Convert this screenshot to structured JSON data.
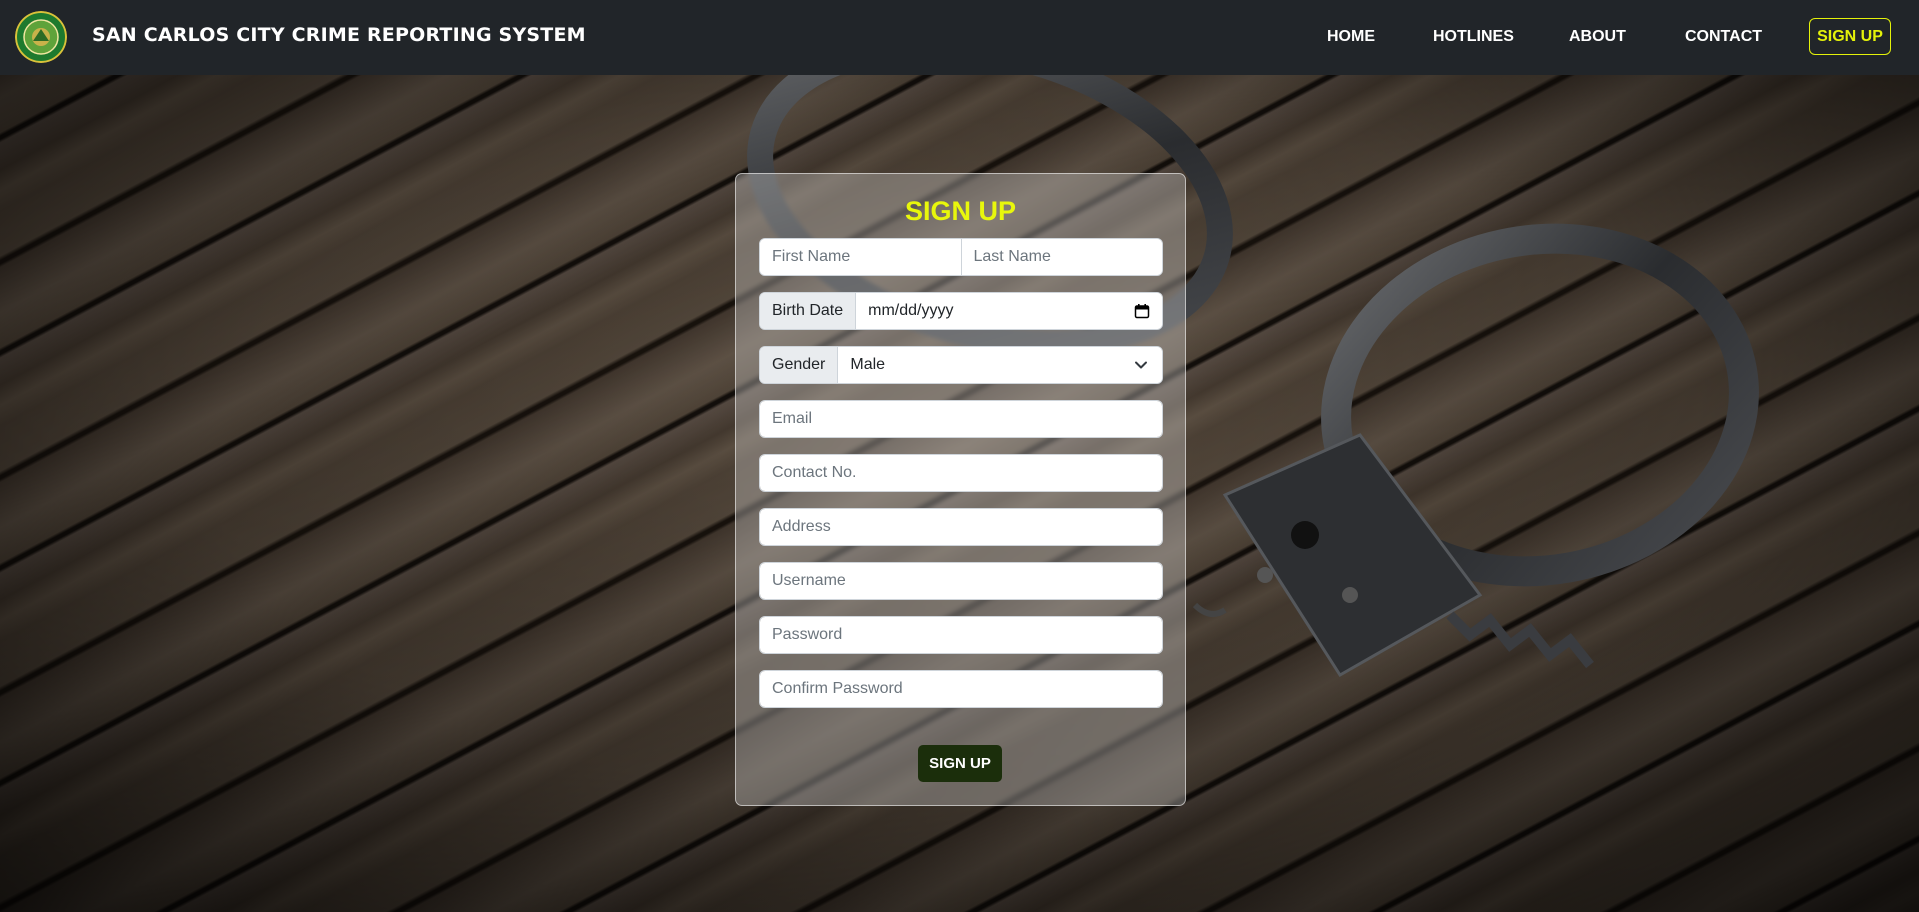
{
  "navbar": {
    "brand": "SAN CARLOS CITY CRIME REPORTING SYSTEM",
    "logo_icon": "city-seal-logo",
    "links": [
      "HOME",
      "HOTLINES",
      "ABOUT",
      "CONTACT"
    ],
    "signup_label": "SIGN UP",
    "bg_color": "#212529",
    "accent_color": "#e4f20a"
  },
  "form": {
    "title": "SIGN UP",
    "first_name_placeholder": "First Name",
    "last_name_placeholder": "Last Name",
    "birth_date_label": "Birth Date",
    "birth_date_value": "mm/dd/yyyy",
    "gender_label": "Gender",
    "gender_value": "Male",
    "email_placeholder": "Email",
    "contact_placeholder": "Contact No.",
    "address_placeholder": "Address",
    "username_placeholder": "Username",
    "password_placeholder": "Password",
    "confirm_password_placeholder": "Confirm Password",
    "submit_label": "SIGN UP",
    "title_color": "#e8f70c",
    "submit_color": "#1b2e0b"
  },
  "background": {
    "image": "handcuffs-on-wood"
  }
}
